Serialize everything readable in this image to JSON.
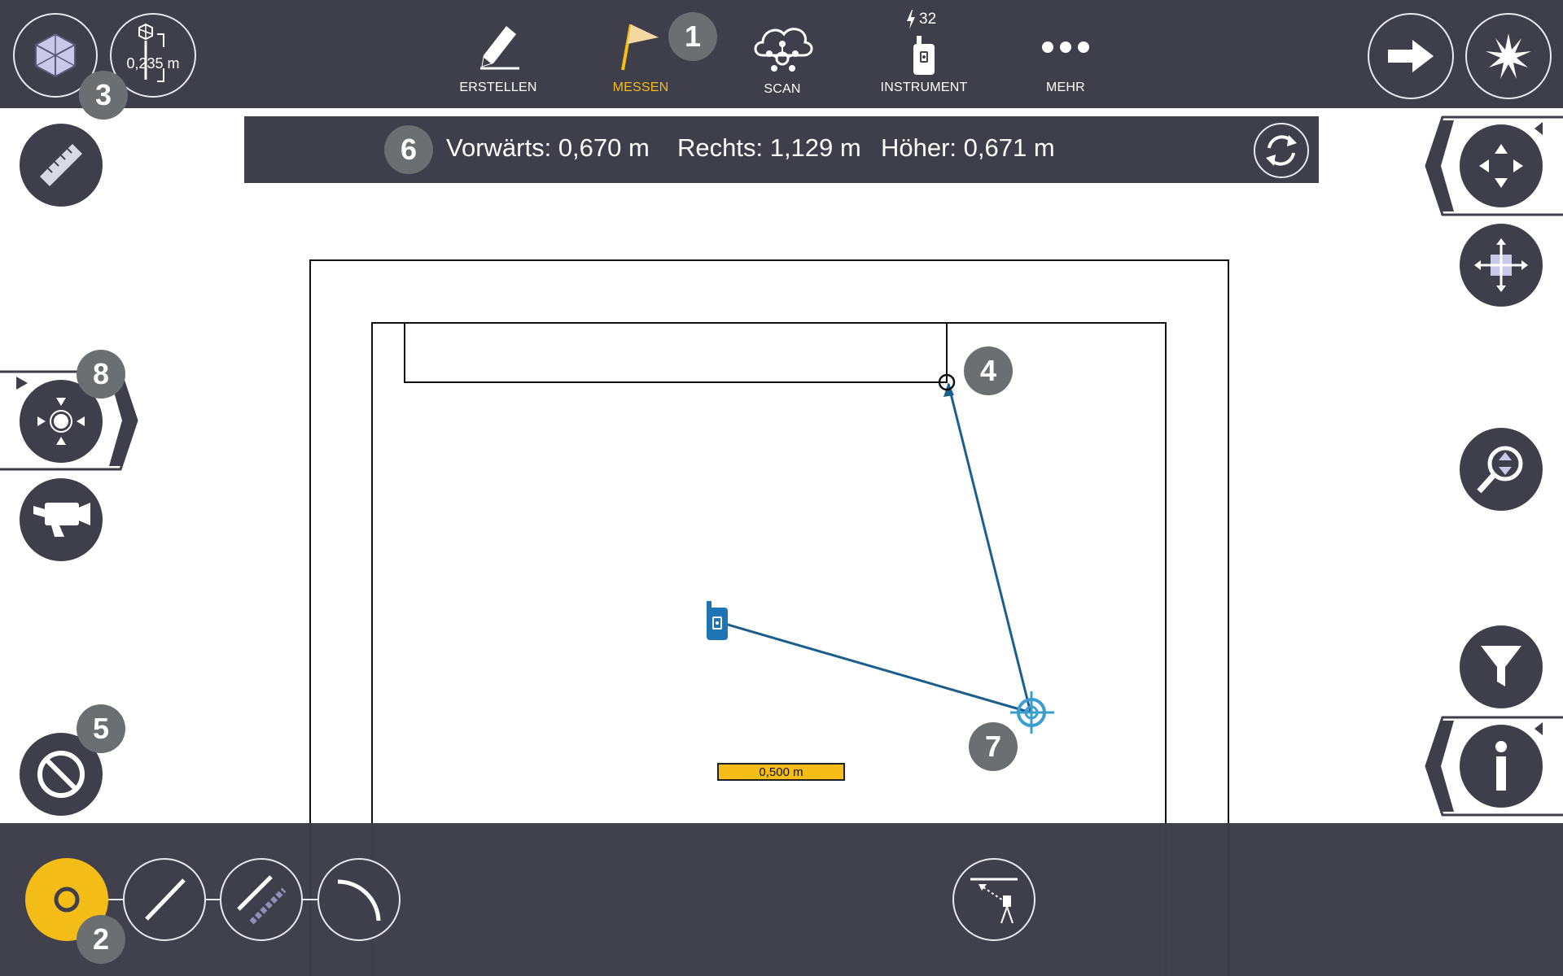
{
  "toolbar": {
    "scale_value": "0,235 m",
    "nav": [
      {
        "label": "ERSTELLEN",
        "icon": "pencil-icon",
        "active": false
      },
      {
        "label": "MESSEN",
        "icon": "flag-icon",
        "active": true
      },
      {
        "label": "SCAN",
        "icon": "cloud-scan-icon",
        "active": false
      },
      {
        "label": "INSTRUMENT",
        "icon": "instrument-icon",
        "active": false
      },
      {
        "label": "MEHR",
        "icon": "more-dots-icon",
        "active": false
      }
    ],
    "instrument_signal": "32"
  },
  "measurement_bar": {
    "forward": "Vorwärts: 0,670 m",
    "right": "Rechts: 1,129 m",
    "higher": "Höher: 0,671 m"
  },
  "map": {
    "scale_label": "0,500 m"
  },
  "callouts": [
    "1",
    "2",
    "3",
    "4",
    "5",
    "6",
    "7",
    "8"
  ],
  "colors": {
    "bar_bg": "#3f3e4b",
    "accent_yellow": "#f5bd17",
    "line_blue": "#1b5e8c",
    "target_cyan": "#3a9fd0",
    "badge_grey": "#6b6f72"
  }
}
